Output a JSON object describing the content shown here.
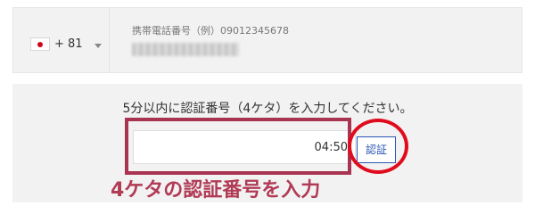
{
  "phone": {
    "country": {
      "flag_icon": "japan-flag-icon",
      "dial_code": "+ 81"
    },
    "field": {
      "label": "携帯電話番号（例）09012345678"
    }
  },
  "verification": {
    "instruction": "5分以内に認証番号（4ケタ）を入力してください。",
    "timer": "04:50",
    "button_label": "認証"
  },
  "annotation": {
    "text": "4ケタの認証番号を入力",
    "rect_color": "#a93452",
    "circle_color": "#e00b1c"
  }
}
